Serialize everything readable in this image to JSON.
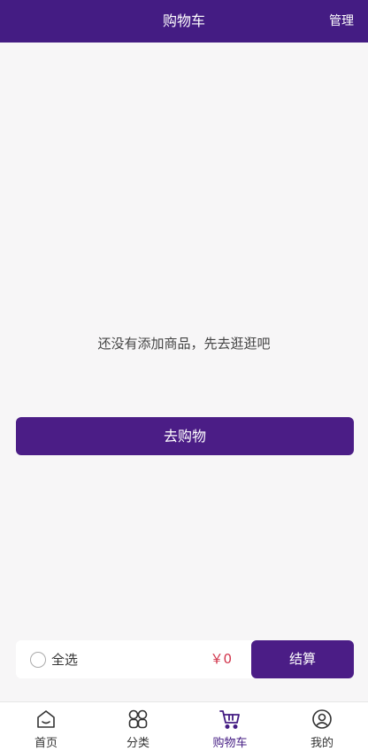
{
  "header": {
    "title": "购物车",
    "manage_label": "管理"
  },
  "empty": {
    "message": "还没有添加商品，先去逛逛吧",
    "button_label": "去购物"
  },
  "checkout": {
    "select_all_label": "全选",
    "total": "￥0",
    "button_label": "结算"
  },
  "tabbar": {
    "items": [
      {
        "label": "首页",
        "icon": "home-icon"
      },
      {
        "label": "分类",
        "icon": "category-icon"
      },
      {
        "label": "购物车",
        "icon": "cart-icon",
        "active": true
      },
      {
        "label": "我的",
        "icon": "profile-icon"
      }
    ]
  },
  "colors": {
    "accent": "#441c83",
    "price": "#d1344b",
    "background": "#f7f6f7"
  }
}
